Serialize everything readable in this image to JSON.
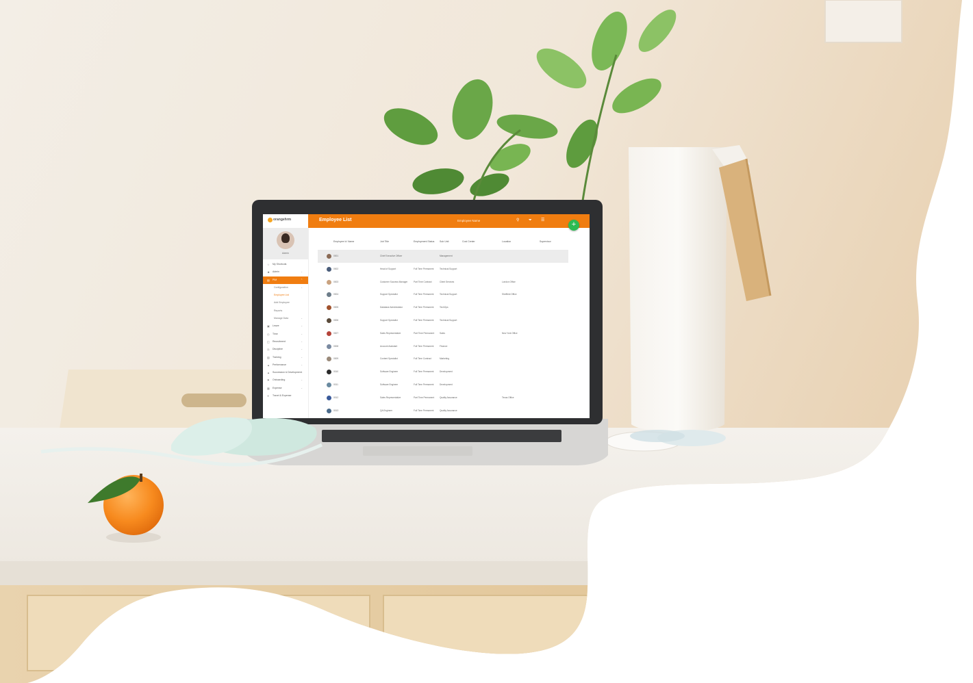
{
  "app": {
    "logo_text": "orangehrm",
    "page_title": "Employee List",
    "search_label": "Employee Name",
    "add_icon": "plus-icon",
    "toolbar_icons": [
      "search-icon",
      "filter-icon",
      "menu-icon"
    ]
  },
  "sidebar": {
    "profile_name": "Admin",
    "items": [
      {
        "label": "My Shortcuts",
        "icon": "star-icon"
      },
      {
        "label": "Admin",
        "icon": "user-icon"
      },
      {
        "label": "PIM",
        "icon": "id-card-icon"
      },
      {
        "label": "Configuration",
        "icon": ""
      },
      {
        "label": "Employee List",
        "icon": ""
      },
      {
        "label": "Add Employee",
        "icon": ""
      },
      {
        "label": "Reports",
        "icon": ""
      },
      {
        "label": "Manage Data",
        "icon": ""
      },
      {
        "label": "Leave",
        "icon": "calendar-icon"
      },
      {
        "label": "Time",
        "icon": "clock-icon"
      },
      {
        "label": "Recruitment",
        "icon": "briefcase-icon"
      },
      {
        "label": "Discipline",
        "icon": "gavel-icon"
      },
      {
        "label": "Training",
        "icon": "book-icon"
      },
      {
        "label": "Performance",
        "icon": "chart-icon"
      },
      {
        "label": "Succession & Development",
        "icon": "tree-icon"
      },
      {
        "label": "Onboarding",
        "icon": "flag-icon"
      },
      {
        "label": "Expense",
        "icon": "wallet-icon"
      },
      {
        "label": "Travel & Expense",
        "icon": "plane-icon"
      }
    ]
  },
  "table": {
    "columns": [
      "Employee Id",
      "Name",
      "Job Title",
      "Employment Status",
      "Sub Unit",
      "Cost Center",
      "Location",
      "Supervisor"
    ],
    "rows": [
      [
        "0001",
        "",
        "Chief Executive Officer",
        "",
        "Management",
        "",
        "",
        ""
      ],
      [
        "0002",
        "",
        "Head of Support",
        "Full Time Permanent",
        "Technical Support",
        "",
        "",
        ""
      ],
      [
        "0003",
        "",
        "Customer Success Manager",
        "Part Time Contract",
        "Client Services",
        "",
        "London Office",
        ""
      ],
      [
        "0004",
        "",
        "Support Specialist",
        "Full Time Permanent",
        "Technical Support",
        "",
        "Sheffield Office",
        ""
      ],
      [
        "0005",
        "",
        "Database Administrator",
        "Full Time Permanent",
        "TechOps",
        "",
        "",
        ""
      ],
      [
        "0006",
        "",
        "Support Specialist",
        "Full Time Permanent",
        "Technical Support",
        "",
        "",
        ""
      ],
      [
        "0007",
        "",
        "Sales Representative",
        "Part Time Permanent",
        "Sales",
        "",
        "New York Office",
        ""
      ],
      [
        "0008",
        "",
        "Account Assistant",
        "Full Time Permanent",
        "Finance",
        "",
        "",
        ""
      ],
      [
        "0009",
        "",
        "Content Specialist",
        "Full Time Contract",
        "Marketing",
        "",
        "",
        ""
      ],
      [
        "0010",
        "",
        "Software Engineer",
        "Full Time Permanent",
        "Development",
        "",
        "",
        ""
      ],
      [
        "0011",
        "",
        "Software Engineer",
        "Full Time Permanent",
        "Development",
        "",
        "",
        ""
      ],
      [
        "0012",
        "",
        "Sales Representative",
        "Part Time Permanent",
        "Quality Assurance",
        "",
        "Texas Office",
        ""
      ],
      [
        "0013",
        "",
        "QA Engineer",
        "Full Time Permanent",
        "Quality Assurance",
        "",
        "",
        ""
      ]
    ]
  },
  "colors": {
    "brand_orange": "#f07d10",
    "add_button_green": "#2dbb52"
  }
}
